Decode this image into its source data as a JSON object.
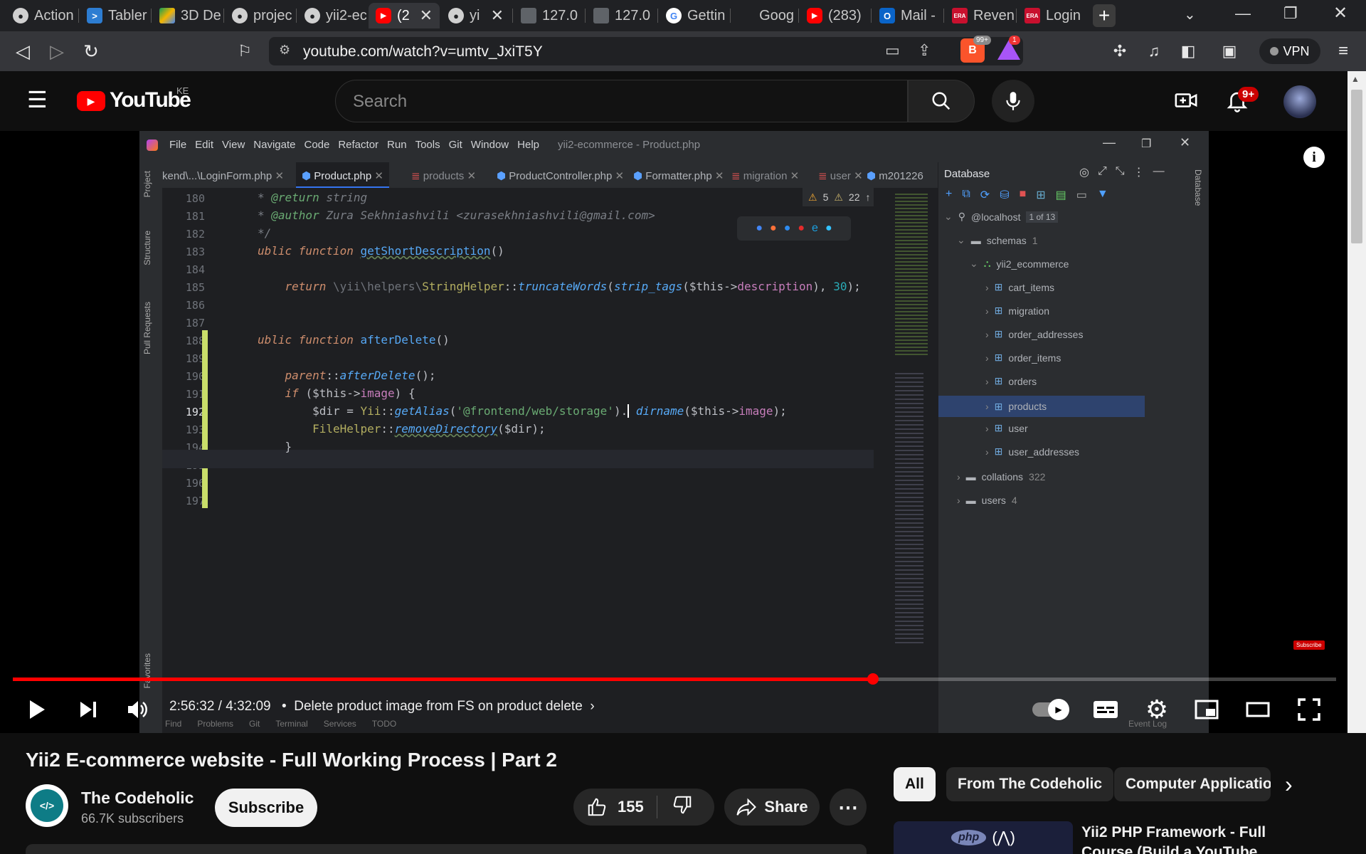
{
  "browser": {
    "tabs": [
      {
        "label": "Action",
        "icon": "github-icon",
        "color": "#d0d0d0"
      },
      {
        "label": "Tabler",
        "icon": "powershell-icon",
        "color": "#2d7dd2"
      },
      {
        "label": "3D De",
        "icon": "drive-icon",
        "color": "#f4b400"
      },
      {
        "label": "projec",
        "icon": "github-icon",
        "color": "#d0d0d0"
      },
      {
        "label": "yii2-ec",
        "icon": "github-icon",
        "color": "#d0d0d0"
      },
      {
        "label": "(2",
        "icon": "youtube-icon",
        "color": "#ff0000",
        "active": true
      },
      {
        "label": "yi",
        "icon": "github-icon",
        "color": "#d0d0d0"
      },
      {
        "label": "127.0",
        "icon": "page-icon",
        "color": "#9aa0a6"
      },
      {
        "label": "127.0",
        "icon": "page-icon",
        "color": "#9aa0a6"
      },
      {
        "label": "Gettin",
        "icon": "google-icon",
        "color": "#ffffff"
      },
      {
        "label": "Goog",
        "icon": "none",
        "color": "#202124"
      },
      {
        "label": "(283)",
        "icon": "youtube-icon",
        "color": "#ff0000"
      },
      {
        "label": "Mail -",
        "icon": "outlook-icon",
        "color": "#0a64c8"
      },
      {
        "label": "Reven",
        "icon": "era-icon",
        "color": "#c8102e"
      },
      {
        "label": "Login",
        "icon": "era-icon",
        "color": "#c8102e"
      }
    ],
    "new_tab_label": "+",
    "url": "youtube.com/watch?v=umtv_JxiT5Y",
    "brave_badge": "99+",
    "alert_badge": "1",
    "vpn_label": "VPN"
  },
  "youtube": {
    "logo_text": "YouTube",
    "region": "KE",
    "search_placeholder": "Search",
    "notif_count": "9+"
  },
  "ide": {
    "menu": [
      "File",
      "Edit",
      "View",
      "Navigate",
      "Code",
      "Refactor",
      "Run",
      "Tools",
      "Git",
      "Window",
      "Help"
    ],
    "title": "yii2-ecommerce - Product.php",
    "tabs": [
      "kend\\...\\LoginForm.php",
      "Product.php",
      "products",
      "ProductController.php",
      "Formatter.php",
      "migration",
      "user",
      "m201226"
    ],
    "side_labels": [
      "Project",
      "Structure",
      "Pull Requests",
      "Favorites"
    ],
    "warnings": "5",
    "weak_warnings": "22",
    "lines": [
      "180",
      "181",
      "182",
      "183",
      "184",
      "185",
      "186",
      "187",
      "188",
      "189",
      "190",
      "191",
      "192",
      "193",
      "194",
      "195",
      "196",
      "197"
    ],
    "db": {
      "title": "Database",
      "host": "@localhost",
      "host_badge": "1 of 13",
      "schemas": "schemas",
      "schemas_count": "1",
      "schema": "yii2_ecommerce",
      "tables": [
        "cart_items",
        "migration",
        "order_addresses",
        "order_items",
        "orders",
        "products",
        "user",
        "user_addresses"
      ],
      "collations": "collations",
      "collations_count": "322",
      "users": "users",
      "users_count": "4",
      "right_label": "Database"
    },
    "bottom": [
      "Find",
      "Problems",
      "Git",
      "Terminal",
      "Services",
      "TODO"
    ],
    "event_log": "Event Log"
  },
  "player": {
    "time": "2:56:32 / 4:32:09",
    "chapter": "Delete product image from FS on product delete",
    "progress_fraction": 0.65,
    "subscribe_watermark": "Subscribe"
  },
  "video": {
    "title": "Yii2 E-commerce website - Full Working Process | Part 2",
    "channel": "The Codeholic",
    "subscribers": "66.7K subscribers",
    "subscribe_label": "Subscribe",
    "likes": "155",
    "share_label": "Share"
  },
  "chips": [
    "All",
    "From The Codeholic",
    "Computer Applicatio"
  ],
  "suggested_title": "Yii2 PHP Framework - Full Course (Build a YouTube Clone)",
  "suggested_thumb_text": "php"
}
